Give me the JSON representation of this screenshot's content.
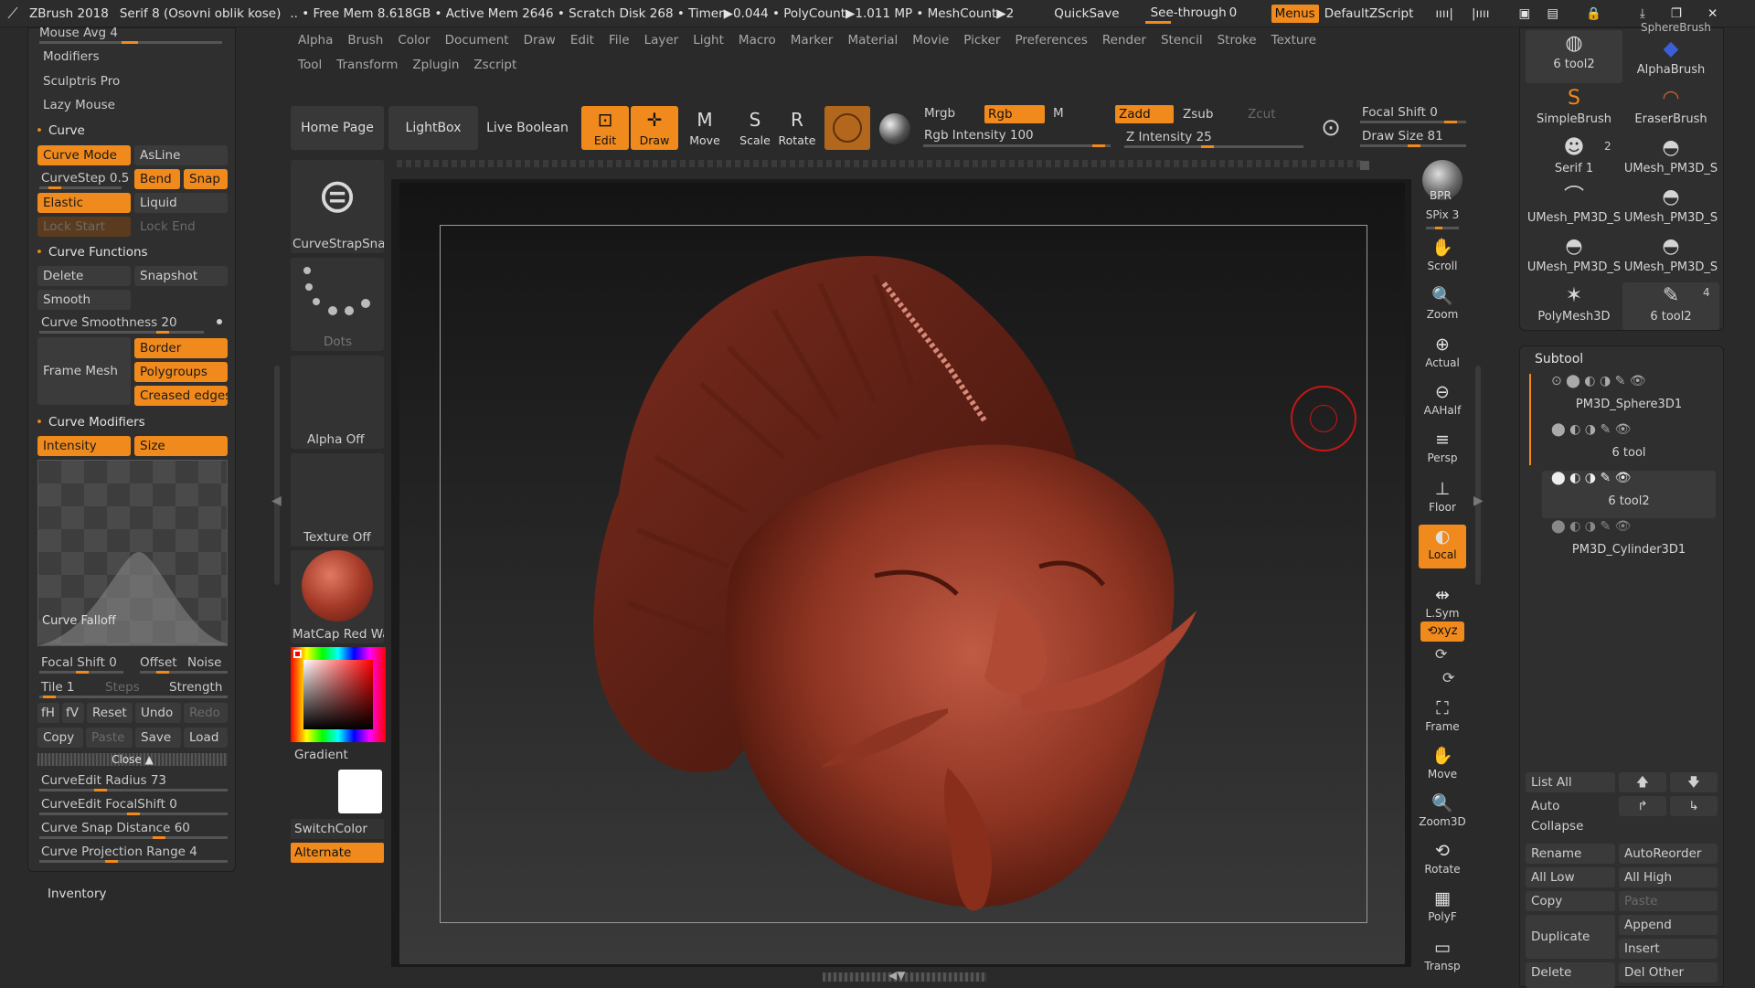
{
  "titlebar": {
    "app": "ZBrush 2018",
    "font": "Serif 8 (Osovni oblik kose)",
    "stats": ".. • Free Mem 8.618GB • Active Mem 2646 • Scratch Disk 268 • Timer▶0.044 • PolyCount▶1.011 MP  • MeshCount▶2",
    "quicksave": "QuickSave",
    "seethrough": "See-through",
    "seethrough_val": "0",
    "menus": "Menus",
    "script": "DefaultZScript"
  },
  "menu_row1": [
    "Alpha",
    "Brush",
    "Color",
    "Document",
    "Draw",
    "Edit",
    "File",
    "Layer",
    "Light",
    "Macro",
    "Marker",
    "Material",
    "Movie",
    "Picker",
    "Preferences",
    "Render",
    "Stencil",
    "Stroke",
    "Texture"
  ],
  "menu_row2": [
    "Tool",
    "Transform",
    "Zplugin",
    "Zscript"
  ],
  "left": {
    "mouse_avg": "Mouse Avg 4",
    "modifiers": "Modifiers",
    "sculptris": "Sculptris Pro",
    "lazy": "Lazy Mouse",
    "curve_sec": "Curve",
    "curve_mode": "Curve Mode",
    "asline": "AsLine",
    "curvestep": "CurveStep 0.5",
    "bend": "Bend",
    "snap": "Snap",
    "elastic": "Elastic",
    "liquid": "Liquid",
    "lock_start": "Lock Start",
    "lock_end": "Lock End",
    "curve_functions": "Curve Functions",
    "delete": "Delete",
    "snapshot": "Snapshot",
    "smooth": "Smooth",
    "curve_smooth": "Curve Smoothness 20",
    "frame_mesh": "Frame Mesh",
    "border": "Border",
    "polygroups": "Polygroups",
    "creased": "Creased edges",
    "curve_modifiers": "Curve Modifiers",
    "intensity": "Intensity",
    "size": "Size",
    "curve_falloff": "Curve Falloff",
    "focal_shift": "Focal Shift 0",
    "offset": "Offset",
    "noise": "Noise",
    "tile": "Tile 1",
    "steps": "Steps",
    "strength": "Strength",
    "fh": "fH",
    "fv": "fV",
    "reset": "Reset",
    "undo": "Undo",
    "redo": "Redo",
    "copy": "Copy",
    "paste": "Paste",
    "save": "Save",
    "load": "Load",
    "close": "Close",
    "edit_radius": "CurveEdit Radius 73",
    "edit_focal": "CurveEdit FocalShift 0",
    "snap_distance": "Curve Snap Distance 60",
    "proj_range": "Curve Projection Range 4",
    "inventory": "Inventory"
  },
  "middle": {
    "home": "Home Page",
    "lightbox": "LightBox",
    "liveboolean": "Live Boolean",
    "brush_name": "CurveStrapSnap",
    "dots": "Dots",
    "alpha_off": "Alpha Off",
    "texture_off": "Texture Off",
    "matcap": "MatCap Red Wax",
    "gradient": "Gradient",
    "switchcolor": "SwitchColor",
    "alternate": "Alternate"
  },
  "toolbar": {
    "edit": "Edit",
    "draw": "Draw",
    "move": "Move",
    "scale": "Scale",
    "rotate": "Rotate",
    "mrgb": "Mrgb",
    "rgb": "Rgb",
    "m": "M",
    "rgb_intensity": "Rgb Intensity 100",
    "zadd": "Zadd",
    "zsub": "Zsub",
    "zcut": "Zcut",
    "z_intensity": "Z Intensity 25",
    "focal_shift": "Focal Shift 0",
    "draw_size": "Draw Size 81"
  },
  "right_tools": [
    "BPR",
    "SPix 3",
    "Scroll",
    "Zoom",
    "Actual",
    "AAHalf",
    "Persp",
    "Floor",
    "Local",
    "L.Sym",
    "Frame",
    "Move",
    "Zoom3D",
    "Rotate",
    "PolyF",
    "Transp"
  ],
  "brushes": [
    {
      "label": "6 tool2",
      "icon": "sphere"
    },
    {
      "label": "AlphaBrush",
      "icon": "alpha"
    },
    {
      "label": "SimpleBrush",
      "icon": "s"
    },
    {
      "label": "EraserBrush",
      "icon": "eraser"
    },
    {
      "label": "Serif 1",
      "icon": "head"
    },
    {
      "label": "UMesh_PM3D_S",
      "icon": "sphere"
    },
    {
      "label": "UMesh_PM3D_S",
      "icon": "hook"
    },
    {
      "label": "UMesh_PM3D_S",
      "icon": "sphere"
    },
    {
      "label": "UMesh_PM3D_S",
      "icon": "sphere"
    },
    {
      "label": "UMesh_PM3D_S",
      "icon": "sphere"
    },
    {
      "label": "PolyMesh3D",
      "icon": "star"
    },
    {
      "label": "6 tool2",
      "icon": "pen"
    }
  ],
  "brush_badges": {
    "serif": "2",
    "tool2": "4",
    "sphere_top": "SphereBrush"
  },
  "subtool": {
    "title": "Subtool",
    "items": [
      "PM3D_Sphere3D1",
      "6 tool",
      "6 tool2",
      "PM3D_Cylinder3D1"
    ],
    "list_all": "List All",
    "auto_collapse": "Auto Collapse",
    "rename": "Rename",
    "autoreorder": "AutoReorder",
    "all_low": "All Low",
    "all_high": "All High",
    "copy": "Copy",
    "paste": "Paste",
    "duplicate": "Duplicate",
    "append": "Append",
    "insert": "Insert",
    "del_other": "Del Other",
    "delete": "Delete"
  },
  "colors": {
    "accent": "#f18a1c",
    "model": "#a0402e"
  }
}
